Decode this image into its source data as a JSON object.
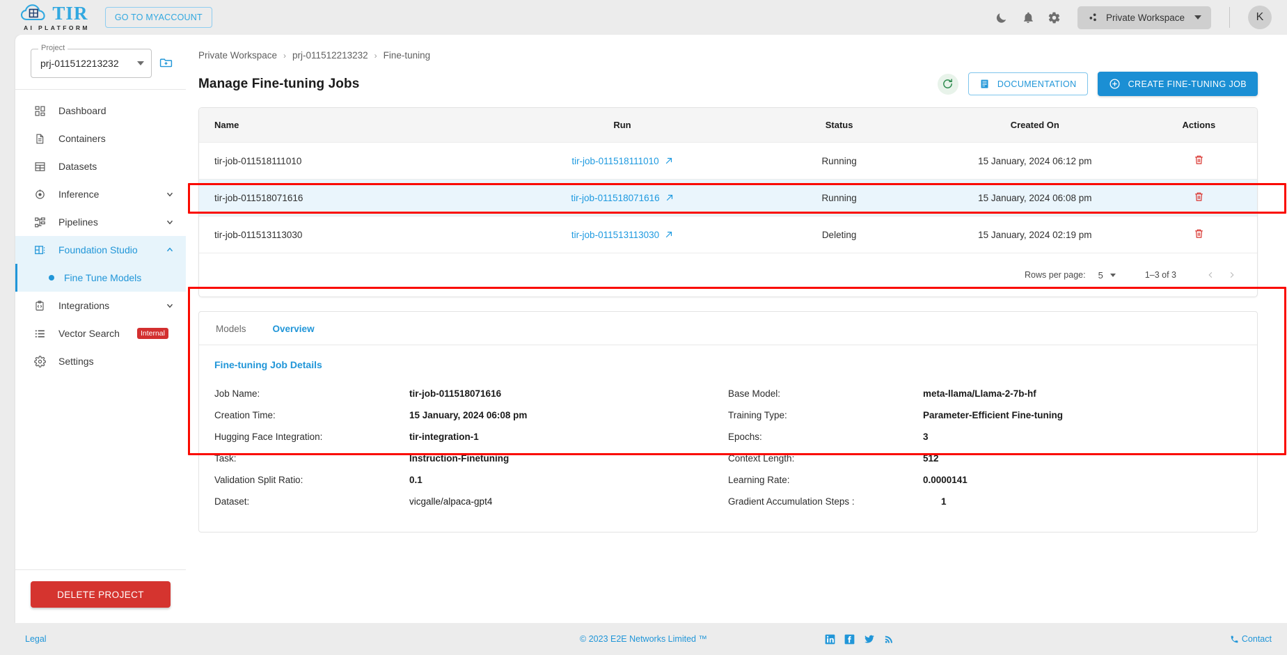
{
  "header": {
    "brand_name": "TIR",
    "brand_tagline": "AI PLATFORM",
    "myaccount_label": "GO TO MYACCOUNT",
    "dark_mode_icon": "moon-icon",
    "notifications_icon": "bell-icon",
    "settings_icon": "gear-icon",
    "workspace_label": "Private Workspace",
    "workspace_icon": "workspace-nodes-icon",
    "avatar_initial": "K"
  },
  "sidebar": {
    "project_label": "Project",
    "project_value": "prj-011512213232",
    "new_project_icon": "folder-add-icon",
    "items": [
      {
        "label": "Dashboard",
        "icon": "dashboard-grid-icon",
        "expandable": false,
        "active": false
      },
      {
        "label": "Containers",
        "icon": "document-icon",
        "expandable": false,
        "active": false
      },
      {
        "label": "Datasets",
        "icon": "table-grid-icon",
        "expandable": false,
        "active": false
      },
      {
        "label": "Inference",
        "icon": "target-icon",
        "expandable": true,
        "active": false
      },
      {
        "label": "Pipelines",
        "icon": "pipeline-icon",
        "expandable": true,
        "active": false
      },
      {
        "label": "Foundation Studio",
        "icon": "studio-icon",
        "expandable": true,
        "active": true
      },
      {
        "label": "Integrations",
        "icon": "code-clipboard-icon",
        "expandable": true,
        "active": false
      },
      {
        "label": "Vector Search",
        "icon": "list-icon",
        "expandable": false,
        "active": false,
        "badge": "Internal"
      },
      {
        "label": "Settings",
        "icon": "gear-icon",
        "expandable": false,
        "active": false
      }
    ],
    "sub_item": {
      "label": "Fine Tune Models",
      "parent": "Foundation Studio"
    },
    "delete_project_label": "DELETE PROJECT"
  },
  "breadcrumb": {
    "items": [
      "Private Workspace",
      "prj-011512213232",
      "Fine-tuning"
    ],
    "separator": "›"
  },
  "page": {
    "title": "Manage Fine-tuning Jobs",
    "refresh_icon": "refresh-icon",
    "documentation_label": "DOCUMENTATION",
    "documentation_icon": "book-icon",
    "create_label": "CREATE FINE-TUNING JOB",
    "create_icon": "plus-circle-icon"
  },
  "table": {
    "columns": [
      "Name",
      "Run",
      "Status",
      "Created On",
      "Actions"
    ],
    "rows": [
      {
        "name": "tir-job-011518111010",
        "run": "tir-job-011518111010",
        "status": "Running",
        "created_on": "15 January, 2024 06:12 pm",
        "action_icon": "trash-icon",
        "selected": false
      },
      {
        "name": "tir-job-011518071616",
        "run": "tir-job-011518071616",
        "status": "Running",
        "created_on": "15 January, 2024 06:08 pm",
        "action_icon": "trash-icon",
        "selected": true
      },
      {
        "name": "tir-job-011513113030",
        "run": "tir-job-011513113030",
        "status": "Deleting",
        "created_on": "15 January, 2024 02:19 pm",
        "action_icon": "trash-icon",
        "selected": false
      }
    ],
    "run_link_icon": "external-link-arrow-icon"
  },
  "pagination": {
    "rows_per_page_label": "Rows per page:",
    "rows_per_page_value": "5",
    "range_label": "1–3 of 3",
    "prev_icon": "chevron-left-icon",
    "next_icon": "chevron-right-icon"
  },
  "details": {
    "tabs": [
      {
        "label": "Models",
        "active": false
      },
      {
        "label": "Overview",
        "active": true
      }
    ],
    "heading": "Fine-tuning Job Details",
    "left_fields": [
      {
        "label": "Job Name:",
        "value": "tir-job-011518071616",
        "bold": true
      },
      {
        "label": "Creation Time:",
        "value": "15 January, 2024 06:08 pm",
        "bold": true
      },
      {
        "label": "Hugging Face Integration:",
        "value": "tir-integration-1",
        "bold": true
      },
      {
        "label": "Task:",
        "value": "Instruction-Finetuning",
        "bold": true
      },
      {
        "label": "Validation Split Ratio:",
        "value": "0.1",
        "bold": true
      },
      {
        "label": "Dataset:",
        "value": "vicgalle/alpaca-gpt4",
        "bold": false
      }
    ],
    "right_fields": [
      {
        "label": "Base Model:",
        "value": "meta-llama/Llama-2-7b-hf",
        "bold": true
      },
      {
        "label": "Training Type:",
        "value": "Parameter-Efficient Fine-tuning",
        "bold": true
      },
      {
        "label": "Epochs:",
        "value": "3",
        "bold": true
      },
      {
        "label": "Context Length:",
        "value": "512",
        "bold": true
      },
      {
        "label": "Learning Rate:",
        "value": "0.0000141",
        "bold": true
      },
      {
        "label": "Gradient Accumulation Steps :",
        "value": "1",
        "bold": true,
        "indent": true
      }
    ]
  },
  "footer": {
    "legal_label": "Legal",
    "copyright": "© 2023 E2E Networks Limited ™",
    "social": [
      "linkedin-icon",
      "facebook-icon",
      "twitter-icon",
      "rss-icon"
    ],
    "contact_label": "Contact",
    "contact_icon": "phone-icon"
  },
  "colors": {
    "accent_blue": "#2196d8",
    "danger_red": "#d5342f",
    "highlight_red": "#fa0a00",
    "selected_row_bg": "#eaf5fc",
    "page_bg": "#ececec"
  }
}
